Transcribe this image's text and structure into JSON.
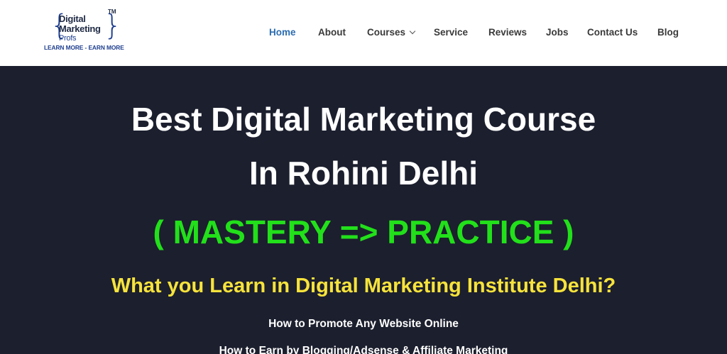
{
  "logo": {
    "line1": "Digital",
    "line2": "Marketing",
    "line3": "Profs",
    "trademark": "TM",
    "tagline": "LEARN MORE - EARN MORE"
  },
  "nav": {
    "items": [
      {
        "label": "Home",
        "active": true
      },
      {
        "label": "About"
      },
      {
        "label": "Courses",
        "has_dropdown": true
      },
      {
        "label": "Service"
      },
      {
        "label": "Reviews"
      },
      {
        "label": "Jobs"
      },
      {
        "label": "Contact Us"
      },
      {
        "label": "Blog"
      }
    ]
  },
  "hero": {
    "title_line1": "Best Digital Marketing Course",
    "title_line2": "In Rohini Delhi",
    "mastery": "( MASTERY => PRACTICE )",
    "question": "What you Learn in Digital Marketing Institute Delhi?",
    "learn_items": [
      "How to Promote Any Website Online",
      "How to Earn by Blogging/Adsense & Affiliate Marketing"
    ]
  },
  "colors": {
    "hero_bg": "#1c1f2e",
    "active_nav": "#2b6cb0",
    "mastery": "#22e01a",
    "question": "#f7e33b",
    "logo_blue": "#1f3f8f"
  }
}
